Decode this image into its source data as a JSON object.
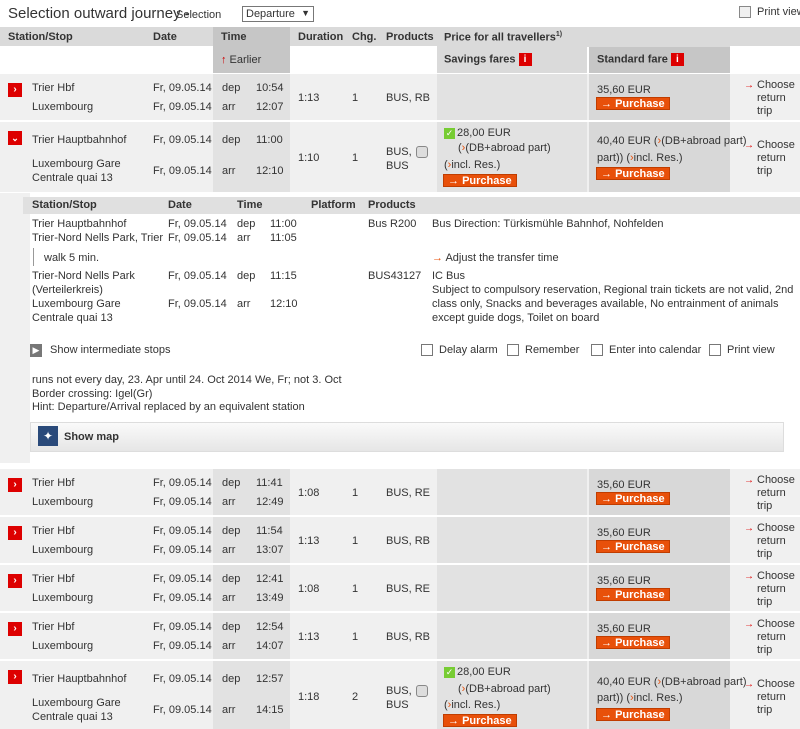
{
  "header": {
    "title": "Selection outward journey",
    "dash": "-",
    "selection_label": "Selection",
    "select_value": "Departure",
    "print": "Print view"
  },
  "columns": {
    "station": "Station/Stop",
    "date": "Date",
    "time": "Time",
    "duration": "Duration",
    "chg": "Chg.",
    "products": "Products",
    "price": "Price for all travellers",
    "price_sup": "1)",
    "savings": "Savings fares",
    "standard": "Standard fare",
    "earlier": "Earlier"
  },
  "labels": {
    "dep": "dep",
    "arr": "arr",
    "purchase": "Purchase",
    "choose": [
      "Choose",
      "return",
      "trip"
    ],
    "db": "(DB+abroad part)",
    "incl": "incl. Res."
  },
  "journeys": [
    {
      "from": "Trier Hbf",
      "to": "Luxembourg",
      "date1": "Fr, 09.05.14",
      "date2": "Fr, 09.05.14",
      "dep": "10:54",
      "arr": "12:07",
      "duration": "1:13",
      "chg": "1",
      "products": "BUS, RB",
      "standard": "35,60 EUR"
    },
    {
      "from": "Trier Hauptbahnhof",
      "to1": "Luxembourg Gare",
      "to2": "Centrale quai 13",
      "date1": "Fr, 09.05.14",
      "date2": "Fr, 09.05.14",
      "dep": "11:00",
      "arr": "12:10",
      "duration": "1:10",
      "chg": "1",
      "products1": "BUS,",
      "products2": "BUS",
      "savings": "28,00 EUR",
      "standard": "40,40 EUR"
    },
    {
      "from": "Trier Hbf",
      "to": "Luxembourg",
      "date1": "Fr, 09.05.14",
      "date2": "Fr, 09.05.14",
      "dep": "11:41",
      "arr": "12:49",
      "duration": "1:08",
      "chg": "1",
      "products": "BUS, RE",
      "standard": "35,60 EUR"
    },
    {
      "from": "Trier Hbf",
      "to": "Luxembourg",
      "date1": "Fr, 09.05.14",
      "date2": "Fr, 09.05.14",
      "dep": "11:54",
      "arr": "13:07",
      "duration": "1:13",
      "chg": "1",
      "products": "BUS, RB",
      "standard": "35,60 EUR"
    },
    {
      "from": "Trier Hbf",
      "to": "Luxembourg",
      "date1": "Fr, 09.05.14",
      "date2": "Fr, 09.05.14",
      "dep": "12:41",
      "arr": "13:49",
      "duration": "1:08",
      "chg": "1",
      "products": "BUS, RE",
      "standard": "35,60 EUR"
    },
    {
      "from": "Trier Hbf",
      "to": "Luxembourg",
      "date1": "Fr, 09.05.14",
      "date2": "Fr, 09.05.14",
      "dep": "12:54",
      "arr": "14:07",
      "duration": "1:13",
      "chg": "1",
      "products": "BUS, RB",
      "standard": "35,60 EUR"
    },
    {
      "from": "Trier Hauptbahnhof",
      "to1": "Luxembourg Gare",
      "to2": "Centrale quai 13",
      "date1": "Fr, 09.05.14",
      "date2": "Fr, 09.05.14",
      "dep": "12:57",
      "arr": "14:15",
      "duration": "1:18",
      "chg": "2",
      "products1": "BUS,",
      "products2": "BUS",
      "savings": "28,00 EUR",
      "standard": "40,40 EUR"
    }
  ],
  "detail": {
    "cols": {
      "station": "Station/Stop",
      "date": "Date",
      "time": "Time",
      "platform": "Platform",
      "products": "Products"
    },
    "leg1": {
      "from": "Trier Hauptbahnhof",
      "to": "Trier-Nord Nells Park, Trier",
      "date1": "Fr, 09.05.14",
      "date2": "Fr, 09.05.14",
      "dep": "11:00",
      "arr": "11:05",
      "product": "Bus R200",
      "info": "Bus Direction: Türkismühle Bahnhof, Nohfelden"
    },
    "walk": "walk  5 min.",
    "adjust": "Adjust the transfer time",
    "leg2": {
      "from1": "Trier-Nord Nells Park",
      "from2": "(Verteilerkreis)",
      "to1": "Luxembourg Gare",
      "to2": "Centrale quai 13",
      "date1": "Fr, 09.05.14",
      "date2": "Fr, 09.05.14",
      "dep": "11:15",
      "arr": "12:10",
      "product": "BUS43127",
      "info1": "IC Bus",
      "info2": "Subject to compulsory reservation, Regional train tickets are not valid, 2nd",
      "info3": "class only, Snacks and beverages available, No entrainment of animals",
      "info4": "except guide dogs, Toilet on board"
    },
    "show_stops": "Show intermediate stops",
    "delay": "Delay alarm",
    "remember": "Remember",
    "calendar": "Enter into calendar",
    "print": "Print view",
    "note1": "runs not every day, 23. Apr until 24. Oct 2014 We, Fr; not 3. Oct",
    "note2": "Border crossing: Igel(Gr)",
    "note3": "Hint: Departure/Arrival replaced by an equivalent station",
    "show_map": "Show map"
  }
}
